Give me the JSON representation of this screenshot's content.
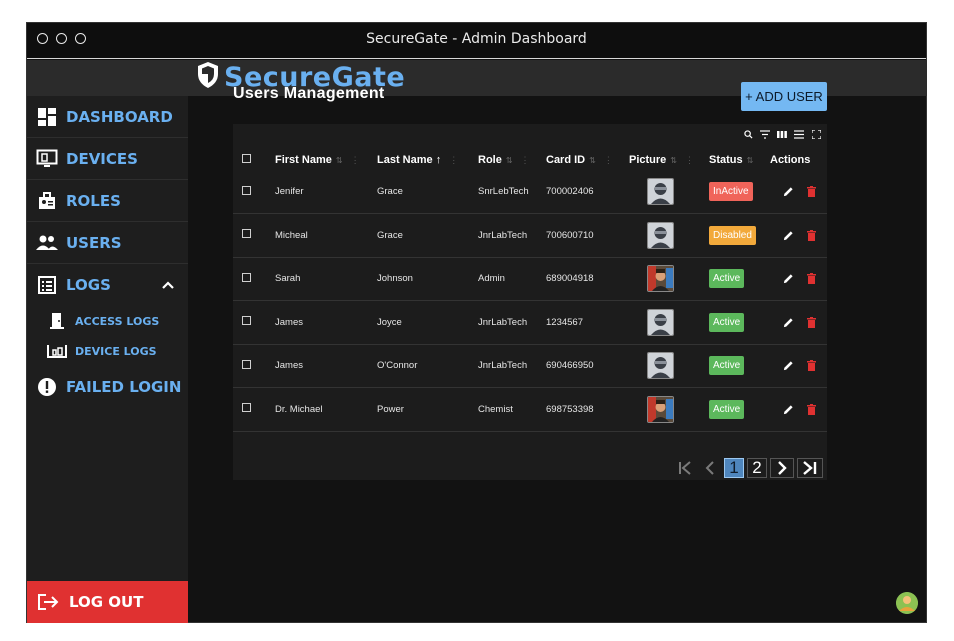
{
  "window": {
    "title": "SecureGate - Admin Dashboard"
  },
  "brand": {
    "name": "SecureGate",
    "color": "#6ab0f0"
  },
  "sidebar": {
    "items": [
      {
        "label": "DASHBOARD",
        "icon": "dashboard-icon"
      },
      {
        "label": "DEVICES",
        "icon": "devices-icon"
      },
      {
        "label": "ROLES",
        "icon": "roles-icon"
      },
      {
        "label": "USERS",
        "icon": "users-icon"
      },
      {
        "label": "LOGS",
        "icon": "logs-icon",
        "expanded": true
      },
      {
        "label": "FAILED LOGIN",
        "icon": "alert-icon"
      }
    ],
    "subitems": [
      {
        "label": "ACCESS LOGS",
        "icon": "door-icon"
      },
      {
        "label": "DEVICE LOGS",
        "icon": "monitor-icon"
      }
    ],
    "logout_label": "LOG OUT",
    "logout_color": "#e03131"
  },
  "main": {
    "title": "Users Management",
    "add_button": "+ ADD USER",
    "columns": [
      "First Name",
      "Last Name",
      "Role",
      "Card ID",
      "Picture",
      "Status",
      "Actions"
    ],
    "sort_indicator": "↑",
    "rows": [
      {
        "first": "Jenifer",
        "last": "Grace",
        "role": "SnrLebTech",
        "card": "700002406",
        "picture": "avatar-cartoon",
        "status": "InActive"
      },
      {
        "first": "Micheal",
        "last": "Grace",
        "role": "JnrLabTech",
        "card": "700600710",
        "picture": "avatar-cartoon",
        "status": "Disabled"
      },
      {
        "first": "Sarah",
        "last": "Johnson",
        "role": "Admin",
        "card": "689004918",
        "picture": "avatar-photo",
        "status": "Active"
      },
      {
        "first": "James",
        "last": "Joyce",
        "role": "JnrLabTech",
        "card": "1234567",
        "picture": "avatar-cartoon",
        "status": "Active"
      },
      {
        "first": "James",
        "last": "O'Connor",
        "role": "JnrLabTech",
        "card": "690466950",
        "picture": "avatar-cartoon",
        "status": "Active"
      },
      {
        "first": "Dr. Michael",
        "last": "Power",
        "role": "Chemist",
        "card": "698753398",
        "picture": "avatar-photo",
        "status": "Active"
      }
    ],
    "status_colors": {
      "InActive": "#f0645a",
      "Disabled": "#f2a93b",
      "Active": "#5cb85c"
    },
    "pagination": {
      "first": "|<",
      "prev": "<",
      "pages": [
        "1",
        "2"
      ],
      "current": "1",
      "next": ">",
      "last": ">|"
    }
  }
}
